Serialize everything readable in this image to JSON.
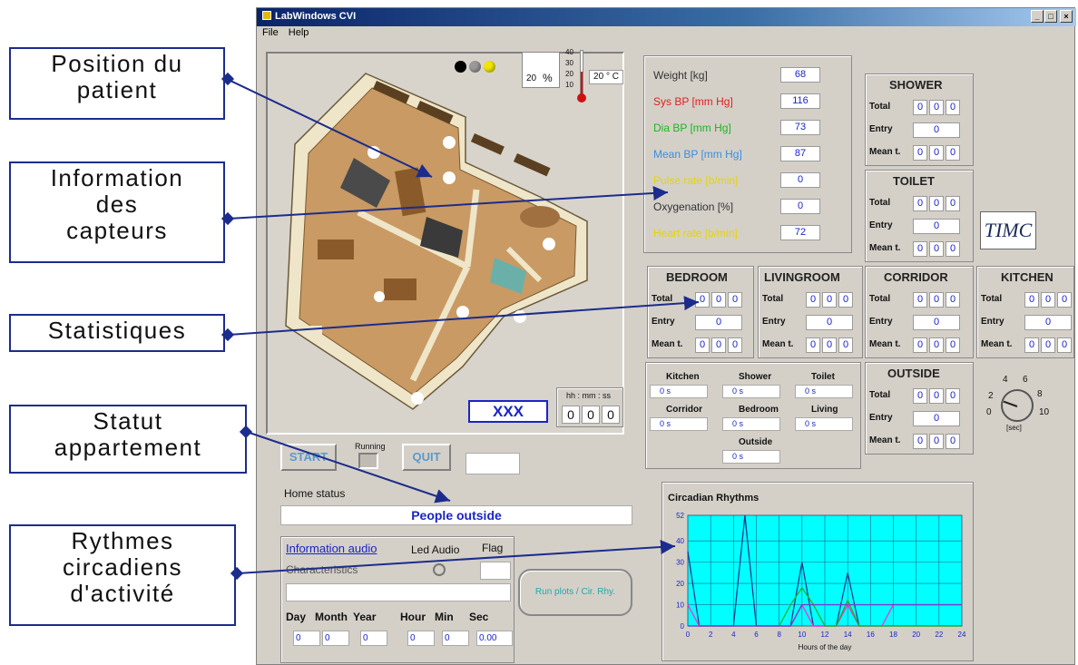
{
  "window": {
    "title": "LabWindows CVI",
    "controls": [
      "_",
      "□",
      "×"
    ],
    "menu": [
      "File",
      "Help"
    ]
  },
  "annotations": [
    {
      "id": "position",
      "lines": [
        "Position du",
        "patient"
      ]
    },
    {
      "id": "information",
      "lines": [
        "Information",
        "des",
        "capteurs"
      ]
    },
    {
      "id": "statistiques",
      "lines": [
        "Statistiques"
      ]
    },
    {
      "id": "statut",
      "lines": [
        "Statut",
        "appartement"
      ]
    },
    {
      "id": "rythmes",
      "lines": [
        "Rythmes",
        "circadiens",
        "d'activité"
      ]
    }
  ],
  "apartment": {
    "humidity_value": "20",
    "humidity_unit": "%",
    "temp_ticks": [
      "40",
      "30",
      "20",
      "10"
    ],
    "temperature": "20 ° C",
    "indicator_colors": [
      "#000000",
      "#9a9a9a",
      "#f2e600"
    ],
    "patient_label": "XXX",
    "clock_label": "hh : mm : ss",
    "clock_values": [
      "0",
      "0",
      "0"
    ]
  },
  "sensors": {
    "rows": [
      {
        "label": "Weight [kg]",
        "value": "68",
        "color": "#333333"
      },
      {
        "label": "Sys BP [mm Hg]",
        "value": "116",
        "color": "#e02020"
      },
      {
        "label": "Dia BP [mm Hg]",
        "value": "73",
        "color": "#1fb41f"
      },
      {
        "label": "Mean BP [mm Hg]",
        "value": "87",
        "color": "#3a8ee0"
      },
      {
        "label": "Pulse rate [b/min]",
        "value": "0",
        "color": "#e6d400"
      },
      {
        "label": "Oxygenation [%]",
        "value": "0",
        "color": "#333333"
      },
      {
        "label": "Heart rate [b/min]",
        "value": "72",
        "color": "#e6d400"
      }
    ]
  },
  "stat_labels": {
    "total": "Total",
    "entry": "Entry",
    "mean": "Mean t."
  },
  "rooms": [
    {
      "id": "shower",
      "name": "SHOWER",
      "total": [
        "0",
        "0",
        "0"
      ],
      "entry": "0",
      "mean": [
        "0",
        "0",
        "0"
      ]
    },
    {
      "id": "toilet",
      "name": "TOILET",
      "total": [
        "0",
        "0",
        "0"
      ],
      "entry": "0",
      "mean": [
        "0",
        "0",
        "0"
      ]
    },
    {
      "id": "bedroom",
      "name": "BEDROOM",
      "total": [
        "0",
        "0",
        "0"
      ],
      "entry": "0",
      "mean": [
        "0",
        "0",
        "0"
      ]
    },
    {
      "id": "livingroom",
      "name": "LIVINGROOM",
      "total": [
        "0",
        "0",
        "0"
      ],
      "entry": "0",
      "mean": [
        "0",
        "0",
        "0"
      ]
    },
    {
      "id": "corridor",
      "name": "CORRIDOR",
      "total": [
        "0",
        "0",
        "0"
      ],
      "entry": "0",
      "mean": [
        "0",
        "0",
        "0"
      ]
    },
    {
      "id": "kitchen",
      "name": "KITCHEN",
      "total": [
        "0",
        "0",
        "0"
      ],
      "entry": "0",
      "mean": [
        "0",
        "0",
        "0"
      ]
    },
    {
      "id": "outside",
      "name": "OUTSIDE",
      "total": [
        "0",
        "0",
        "0"
      ],
      "entry": "0",
      "mean": [
        "0",
        "0",
        "0"
      ]
    }
  ],
  "logo_text": "TIMC",
  "timers": [
    {
      "label": "Kitchen",
      "value": "0 s"
    },
    {
      "label": "Shower",
      "value": "0 s"
    },
    {
      "label": "Toilet",
      "value": "0 s"
    },
    {
      "label": "Corridor",
      "value": "0 s"
    },
    {
      "label": "Bedroom",
      "value": "0 s"
    },
    {
      "label": "Living",
      "value": "0 s"
    },
    {
      "label": "Outside",
      "value": "0 s"
    }
  ],
  "knob": {
    "ticks": [
      "2",
      "4",
      "6",
      "8",
      "10",
      "0"
    ],
    "unit": "[sec]"
  },
  "controls": {
    "start": "START",
    "running": "Running",
    "quit": "QUIT",
    "home_status_label": "Home status",
    "home_status_value": "People outside",
    "tab_audio": "Information audio",
    "led_audio": "Led Audio",
    "flag": "Flag",
    "characteristics": "Characteristics",
    "plot_button": "Run plots / Cir. Rhy.",
    "date_labels": [
      "Day",
      "Month",
      "Year",
      "Hour",
      "Min",
      "Sec"
    ],
    "date_values": [
      "0",
      "0",
      "0",
      "0",
      "0",
      "0.00"
    ]
  },
  "chart_data": {
    "type": "line",
    "title": "Circadian Rhythms",
    "xlabel": "Hours of the day",
    "ylabel": "",
    "xlim": [
      0,
      24
    ],
    "ylim": [
      0,
      52
    ],
    "x_ticks": [
      "0",
      "2",
      "4",
      "6",
      "8",
      "10",
      "12",
      "14",
      "16",
      "18",
      "20",
      "22",
      "24"
    ],
    "y_ticks": [
      "0",
      "10",
      "20",
      "30",
      "40",
      "52"
    ],
    "background": "#00ffff",
    "x": [
      0,
      1,
      2,
      3,
      4,
      5,
      6,
      7,
      8,
      9,
      10,
      11,
      12,
      13,
      14,
      15,
      16,
      17,
      18,
      19,
      20,
      21,
      22,
      23,
      24
    ],
    "series": [
      {
        "color": "#1a3c8c",
        "values": [
          35,
          0,
          0,
          0,
          0,
          52,
          0,
          0,
          0,
          0,
          30,
          0,
          0,
          0,
          25,
          0,
          0,
          0,
          0,
          0,
          0,
          0,
          0,
          0,
          0
        ]
      },
      {
        "color": "#ff2ad8",
        "values": [
          10,
          0,
          0,
          0,
          0,
          0,
          0,
          0,
          0,
          0,
          10,
          0,
          0,
          0,
          10,
          0,
          0,
          0,
          10,
          10,
          10,
          10,
          10,
          10,
          10
        ]
      },
      {
        "color": "#22b022",
        "values": [
          0,
          0,
          0,
          0,
          0,
          0,
          0,
          0,
          0,
          10,
          18,
          10,
          0,
          0,
          12,
          0,
          0,
          0,
          0,
          0,
          0,
          0,
          0,
          0,
          0
        ]
      },
      {
        "color": "#7a3cc8",
        "values": [
          0,
          0,
          0,
          0,
          0,
          0,
          0,
          0,
          0,
          0,
          10,
          10,
          10,
          10,
          10,
          10,
          10,
          10,
          10,
          10,
          10,
          10,
          10,
          10,
          10
        ]
      }
    ]
  }
}
